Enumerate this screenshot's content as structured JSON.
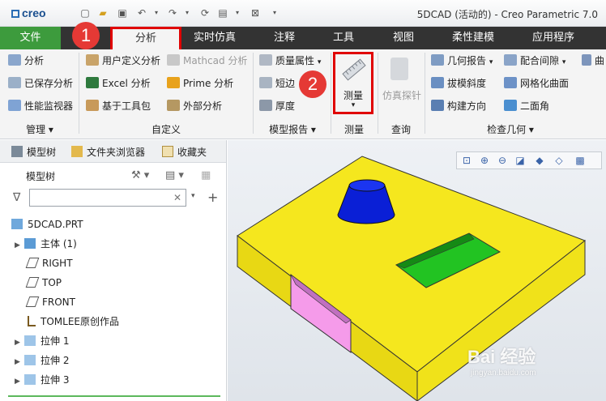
{
  "app": {
    "logo": "creo",
    "window_title": "5DCAD (活动的) - Creo Parametric 7.0"
  },
  "tabs": [
    {
      "label": "文件"
    },
    {
      "label": "分析"
    },
    {
      "label": "实时仿真"
    },
    {
      "label": "注释"
    },
    {
      "label": "工具"
    },
    {
      "label": "视图"
    },
    {
      "label": "柔性建模"
    },
    {
      "label": "应用程序"
    }
  ],
  "ribbon": {
    "manage": {
      "items": [
        "分析",
        "已保存分析",
        "性能监视器"
      ],
      "label": "管理"
    },
    "custom": {
      "items": [
        "用户定义分析",
        "Excel 分析",
        "基于工具包",
        "Mathcad 分析",
        "Prime 分析",
        "外部分析"
      ],
      "label": "自定义"
    },
    "model_report": {
      "items": [
        "质量属性",
        "短边",
        "厚度"
      ],
      "label": "模型报告"
    },
    "measure": {
      "button": "测量",
      "label": "测量"
    },
    "inquiry": {
      "button": "仿真探针",
      "label": "查询"
    },
    "check_geometry": {
      "items": [
        "几何报告",
        "拔模斜度",
        "构建方向",
        "配合间隙",
        "网格化曲面",
        "二面角",
        "曲"
      ],
      "label": "检查几何"
    }
  },
  "left_panel": {
    "tabs": [
      "模型树",
      "文件夹浏览器",
      "收藏夹"
    ],
    "tree_header": "模型树",
    "search_placeholder": "",
    "tree": [
      {
        "label": "5DCAD.PRT"
      },
      {
        "label": "主体 (1)"
      },
      {
        "label": "RIGHT"
      },
      {
        "label": "TOP"
      },
      {
        "label": "FRONT"
      },
      {
        "label": "TOMLEE原创作品"
      },
      {
        "label": "拉伸 1"
      },
      {
        "label": "拉伸 2"
      },
      {
        "label": "拉伸 3"
      }
    ]
  },
  "badges": [
    "1",
    "2"
  ],
  "watermark": {
    "text": "Bai 经验",
    "url": "jingyan.baidu.com"
  },
  "colors": {
    "file_tab": "#3d9b3d",
    "tab_bar": "#333333",
    "highlight": "#e00000",
    "badge": "#e53935",
    "model_body": "#f5e71e",
    "cylinder": "#0a1fd6",
    "pocket_green": "#22c322",
    "pocket_pink": "#f59bea"
  }
}
